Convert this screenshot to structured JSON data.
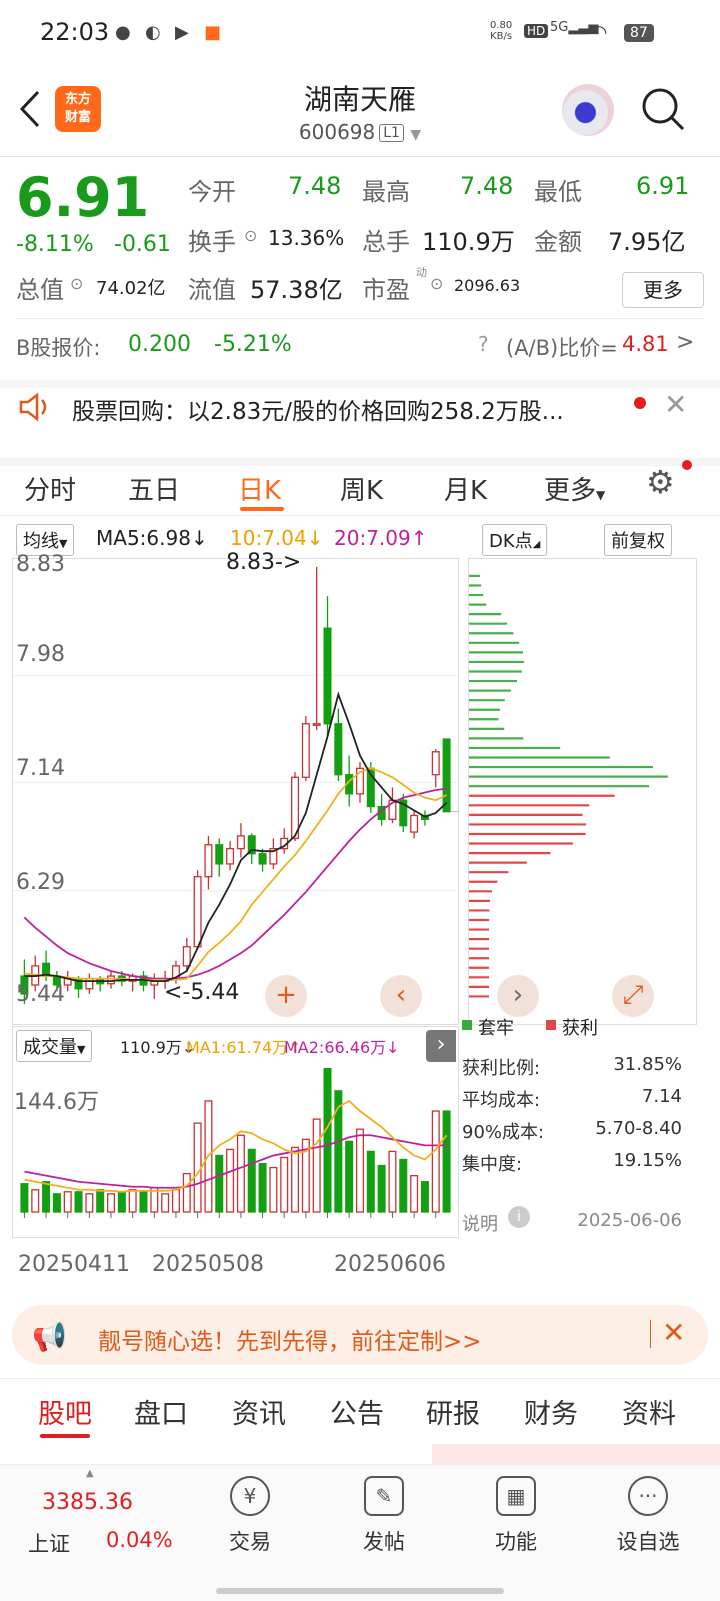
{
  "status_bar": {
    "time": "22:03",
    "speed_value": "0.80",
    "speed_unit": "KB/s",
    "hd": "HD",
    "net": "5G",
    "battery": "87"
  },
  "header": {
    "logo_line1": "东方",
    "logo_line2": "财富",
    "title": "湖南天雁",
    "code": "600698",
    "level": "L1"
  },
  "quote": {
    "price": "6.91",
    "change_pct": "-8.11%",
    "change": "-0.61",
    "open_label": "今开",
    "open": "7.48",
    "high_label": "最高",
    "high": "7.48",
    "low_label": "最低",
    "low": "6.91",
    "turnover_label": "换手",
    "turnover": "13.36%",
    "volume_label": "总手",
    "volume": "110.9万",
    "amount_label": "金额",
    "amount": "7.95亿",
    "mktcap_label": "总值",
    "mktcap": "74.02亿",
    "float_label": "流值",
    "float": "57.38亿",
    "pe_label": "市盈",
    "pe_sup": "动",
    "pe": "2096.63",
    "more": "更多"
  },
  "bshare": {
    "label": "B股报价:",
    "price": "0.200",
    "pct": "-5.21%",
    "ratio_label": "(A/B)比价=",
    "ratio": "4.81"
  },
  "notice": {
    "text": "股票回购：以2.83元/股的价格回购258.2万股..."
  },
  "tabs": [
    "分时",
    "五日",
    "日K",
    "周K",
    "月K",
    "更多"
  ],
  "ma_bar": {
    "selector": "均线",
    "ma5": "MA5:6.98",
    "ma10": "10:7.04",
    "ma20": "20:7.09",
    "dk": "DK点",
    "adjust": "前复权"
  },
  "chart_data": {
    "type": "candlestick",
    "ylim": [
      5.44,
      8.83
    ],
    "y_ticks": [
      "8.83",
      "7.98",
      "7.14",
      "6.29",
      "5.44"
    ],
    "annotations": {
      "high": "8.83->",
      "low": "<-5.44"
    },
    "candles": [
      [
        5.62,
        5.48,
        5.75,
        5.4
      ],
      [
        5.55,
        5.7,
        5.78,
        5.5
      ],
      [
        5.72,
        5.62,
        5.82,
        5.58
      ],
      [
        5.62,
        5.55,
        5.66,
        5.5
      ],
      [
        5.55,
        5.6,
        5.66,
        5.5
      ],
      [
        5.6,
        5.52,
        5.62,
        5.45
      ],
      [
        5.52,
        5.6,
        5.64,
        5.48
      ],
      [
        5.6,
        5.56,
        5.62,
        5.5
      ],
      [
        5.56,
        5.62,
        5.66,
        5.52
      ],
      [
        5.62,
        5.58,
        5.66,
        5.54
      ],
      [
        5.58,
        5.62,
        5.64,
        5.5
      ],
      [
        5.62,
        5.55,
        5.66,
        5.5
      ],
      [
        5.55,
        5.58,
        5.64,
        5.44
      ],
      [
        5.58,
        5.6,
        5.66,
        5.52
      ],
      [
        5.6,
        5.7,
        5.74,
        5.56
      ],
      [
        5.7,
        5.85,
        5.92,
        5.66
      ],
      [
        5.85,
        6.4,
        6.45,
        5.84
      ],
      [
        6.4,
        6.65,
        6.72,
        6.3
      ],
      [
        6.65,
        6.5,
        6.7,
        6.4
      ],
      [
        6.5,
        6.62,
        6.68,
        6.45
      ],
      [
        6.62,
        6.72,
        6.82,
        6.55
      ],
      [
        6.72,
        6.58,
        6.74,
        6.5
      ],
      [
        6.58,
        6.5,
        6.62,
        6.44
      ],
      [
        6.5,
        6.62,
        6.7,
        6.46
      ],
      [
        6.62,
        6.7,
        6.78,
        6.58
      ],
      [
        6.7,
        7.18,
        7.22,
        6.68
      ],
      [
        7.18,
        7.6,
        7.66,
        7.15
      ],
      [
        7.6,
        7.6,
        8.83,
        7.55
      ],
      [
        8.35,
        7.6,
        8.6,
        7.5
      ],
      [
        7.6,
        7.2,
        7.72,
        7.15
      ],
      [
        7.2,
        7.05,
        7.35,
        6.95
      ],
      [
        7.05,
        7.25,
        7.3,
        6.98
      ],
      [
        7.25,
        6.95,
        7.3,
        6.9
      ],
      [
        6.95,
        6.85,
        7.05,
        6.8
      ],
      [
        6.85,
        7.0,
        7.1,
        6.82
      ],
      [
        7.0,
        6.8,
        7.05,
        6.75
      ],
      [
        6.75,
        6.88,
        6.92,
        6.7
      ],
      [
        6.88,
        6.85,
        6.92,
        6.8
      ],
      [
        7.2,
        7.38,
        7.4,
        7.1
      ],
      [
        7.48,
        6.91,
        7.48,
        6.91
      ]
    ],
    "ma5": [
      5.62,
      5.62,
      5.63,
      5.62,
      5.6,
      5.58,
      5.58,
      5.58,
      5.58,
      5.59,
      5.59,
      5.59,
      5.58,
      5.58,
      5.61,
      5.66,
      5.84,
      6.04,
      6.18,
      6.34,
      6.53,
      6.61,
      6.6,
      6.6,
      6.64,
      6.72,
      6.9,
      7.2,
      7.5,
      7.83,
      7.6,
      7.35,
      7.2,
      7.1,
      7.0,
      6.97,
      6.92,
      6.87,
      6.9,
      6.98
    ],
    "ma10": [
      5.64,
      5.63,
      5.62,
      5.62,
      5.61,
      5.6,
      5.6,
      5.6,
      5.6,
      5.6,
      5.59,
      5.59,
      5.59,
      5.59,
      5.59,
      5.6,
      5.7,
      5.81,
      5.88,
      5.96,
      6.05,
      6.18,
      6.28,
      6.38,
      6.48,
      6.57,
      6.68,
      6.8,
      6.92,
      7.05,
      7.15,
      7.22,
      7.25,
      7.22,
      7.18,
      7.12,
      7.06,
      7.02,
      7.0,
      7.04
    ],
    "ma20": [
      6.08,
      6.0,
      5.93,
      5.86,
      5.8,
      5.76,
      5.72,
      5.69,
      5.66,
      5.64,
      5.62,
      5.61,
      5.6,
      5.6,
      5.6,
      5.61,
      5.63,
      5.66,
      5.7,
      5.75,
      5.8,
      5.86,
      5.94,
      6.02,
      6.1,
      6.19,
      6.28,
      6.38,
      6.48,
      6.58,
      6.68,
      6.77,
      6.85,
      6.92,
      6.98,
      7.02,
      7.04,
      7.06,
      7.08,
      7.09
    ],
    "dist_legend": {
      "trapped": "套牢",
      "profit": "获利"
    },
    "dist_stats": [
      {
        "label": "获利比例:",
        "value": "31.85%"
      },
      {
        "label": "平均成本:",
        "value": "7.14"
      },
      {
        "label": "90%成本:",
        "value": "5.70-8.40"
      },
      {
        "label": "集中度:",
        "value": "19.15%"
      }
    ],
    "dist_note": "说明",
    "dist_date": "2025-06-06",
    "volume_header": {
      "selector": "成交量",
      "vol": "110.9万",
      "ma1": "MA1:61.74万",
      "ma2": "MA2:66.46万"
    },
    "volume_max_label": "144.6万",
    "volume": [
      28,
      22,
      30,
      18,
      20,
      20,
      18,
      22,
      18,
      20,
      22,
      20,
      24,
      18,
      22,
      38,
      88,
      110,
      56,
      62,
      76,
      62,
      48,
      44,
      54,
      64,
      72,
      92,
      142,
      120,
      70,
      82,
      60,
      46,
      60,
      52,
      36,
      30,
      100,
      100
    ],
    "vol_ma1": [
      32,
      30,
      28,
      26,
      24,
      22,
      22,
      21,
      21,
      20,
      21,
      21,
      21,
      21,
      22,
      26,
      38,
      56,
      66,
      72,
      80,
      78,
      72,
      68,
      62,
      58,
      60,
      68,
      84,
      104,
      110,
      100,
      92,
      84,
      74,
      64,
      56,
      52,
      62,
      76
    ],
    "vol_ma2": [
      40,
      38,
      36,
      34,
      32,
      30,
      29,
      28,
      27,
      26,
      25,
      25,
      24,
      24,
      24,
      25,
      28,
      32,
      36,
      40,
      44,
      48,
      52,
      56,
      58,
      60,
      62,
      64,
      66,
      70,
      74,
      76,
      76,
      74,
      72,
      70,
      68,
      66,
      66,
      66
    ],
    "x_ticks": [
      "20250411",
      "20250508",
      "20250606"
    ]
  },
  "promo": {
    "text": "靓号随心选！先到先得，前往定制>>"
  },
  "bottom_tabs": [
    "股吧",
    "盘口",
    "资讯",
    "公告",
    "研报",
    "财务",
    "资料"
  ],
  "index": {
    "value": "3385.36",
    "name": "上证",
    "pct": "0.04%"
  },
  "nav": [
    {
      "label": "交易",
      "icon": "¥"
    },
    {
      "label": "发帖",
      "icon": "✎"
    },
    {
      "label": "功能",
      "icon": "▦"
    },
    {
      "label": "设自选",
      "icon": "···"
    }
  ]
}
